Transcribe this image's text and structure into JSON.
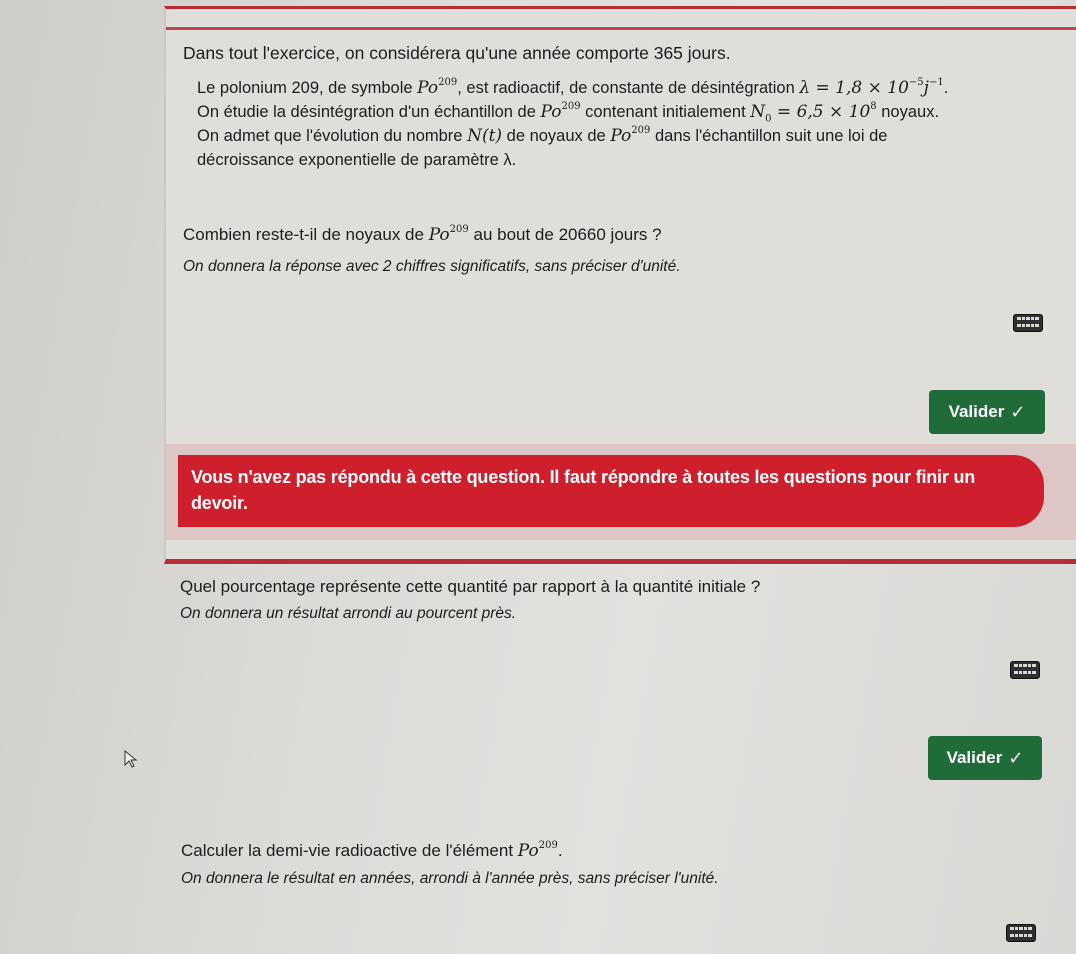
{
  "intro": "Dans tout l'exercice, on considérera qu'une année comporte 365 jours.",
  "statement": {
    "l1a": "Le polonium 209, de symbole ",
    "po": "Po",
    "sup209": "209",
    "l1b": ", est radioactif, de constante de désintégration ",
    "lambda_expr": "λ = 1,8 × 10",
    "lambda_exp": "−5",
    "lambda_unit": "j",
    "lambda_unit_exp": "−1",
    "l1c": ".",
    "l2a": "On étudie la désintégration d'un échantillon de ",
    "l2b": " contenant initialement ",
    "n0_lhs": "N",
    "n0_sub": "0",
    "n0_rhs": " = 6,5 × 10",
    "n0_exp": "8",
    "l2c": " noyaux.",
    "l3a": "On admet que l'évolution du nombre ",
    "nt": "N(t)",
    "l3b": " de noyaux de ",
    "l3c": " dans l'échantillon suit une loi de",
    "l4": "décroissance exponentielle de paramètre λ."
  },
  "q1": {
    "a": "Combien reste-t-il de noyaux de ",
    "b": " au bout de 20660 jours ?",
    "hint": "On donnera la réponse avec 2 chiffres significatifs, sans préciser d'unité.",
    "button": "Valider",
    "error": "Vous n'avez pas répondu à cette question. Il faut répondre à toutes les questions pour finir un devoir."
  },
  "q2": {
    "text": "Quel pourcentage représente cette quantité par rapport à la quantité initiale ?",
    "hint": "On donnera un résultat arrondi au pourcent près.",
    "button": "Valider"
  },
  "q3": {
    "a": "Calculer la demi-vie radioactive de l'élément ",
    "b": ".",
    "hint": "On donnera le résultat en années, arrondi à l'année près, sans préciser l'unité."
  },
  "icons": {
    "keyboard": "keyboard-icon",
    "check": "✓",
    "cursor": "mouse-pointer-icon"
  },
  "colors": {
    "button_green": "#1f6b3a",
    "error_red": "#cf1f2d",
    "frame_red": "#b52d35"
  }
}
